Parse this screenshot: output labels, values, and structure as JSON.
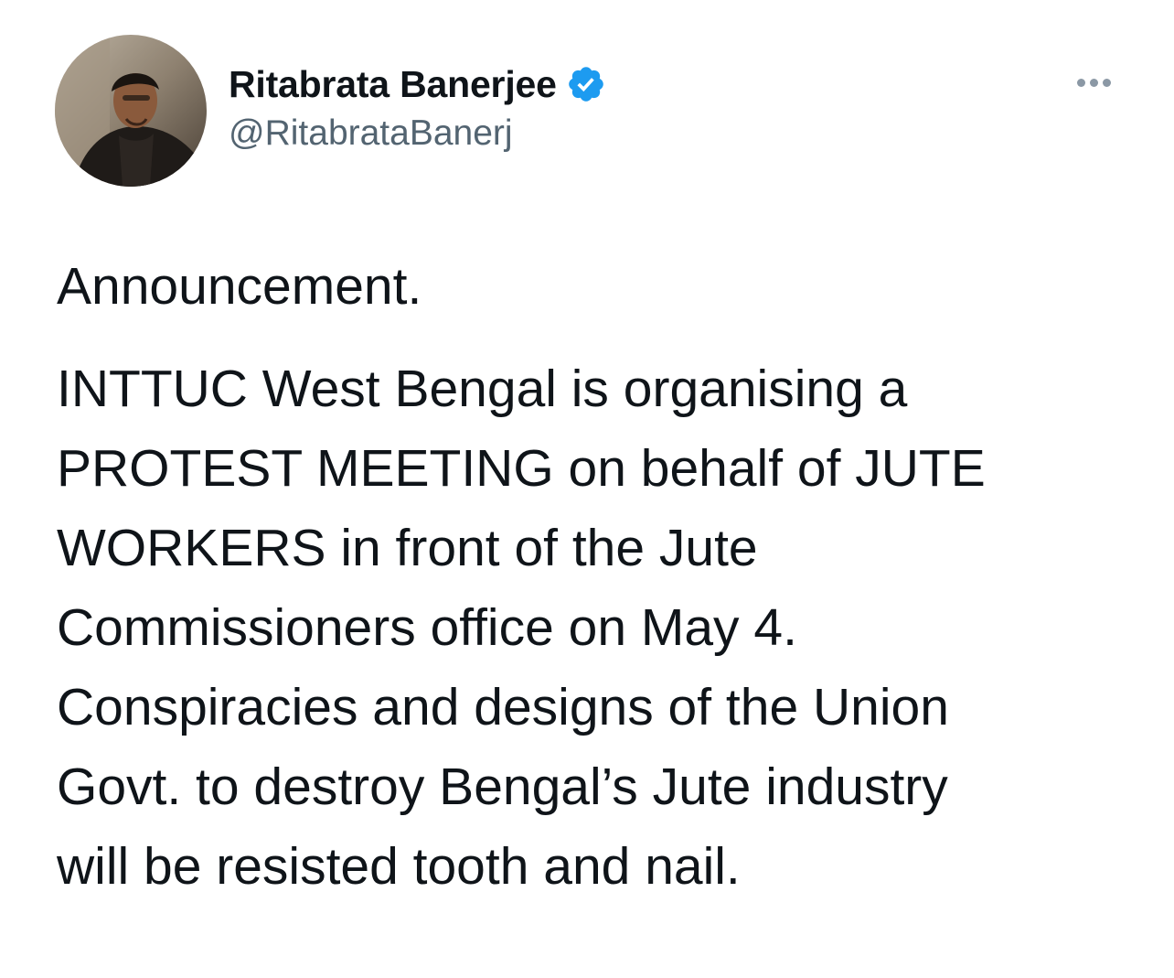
{
  "author": {
    "display_name": "Ritabrata Banerjee",
    "handle": "@RitabrataBanerj",
    "verified": true,
    "verified_color": "#1d9bf0",
    "avatar_icon": "profile-photo"
  },
  "menu": {
    "icon": "more-options-icon"
  },
  "tweet": {
    "headline": "Announcement.",
    "body_lines": [
      "INTTUC West Bengal is organising a",
      "PROTEST MEETING on behalf of JUTE",
      "WORKERS in front of the Jute",
      "Commissioners office on May 4.",
      "Conspiracies and designs of the Union",
      "Govt. to destroy Bengal’s Jute industry",
      "will be resisted tooth and nail."
    ]
  },
  "colors": {
    "text_primary": "#0f1419",
    "text_secondary": "#536471",
    "background": "#ffffff"
  }
}
